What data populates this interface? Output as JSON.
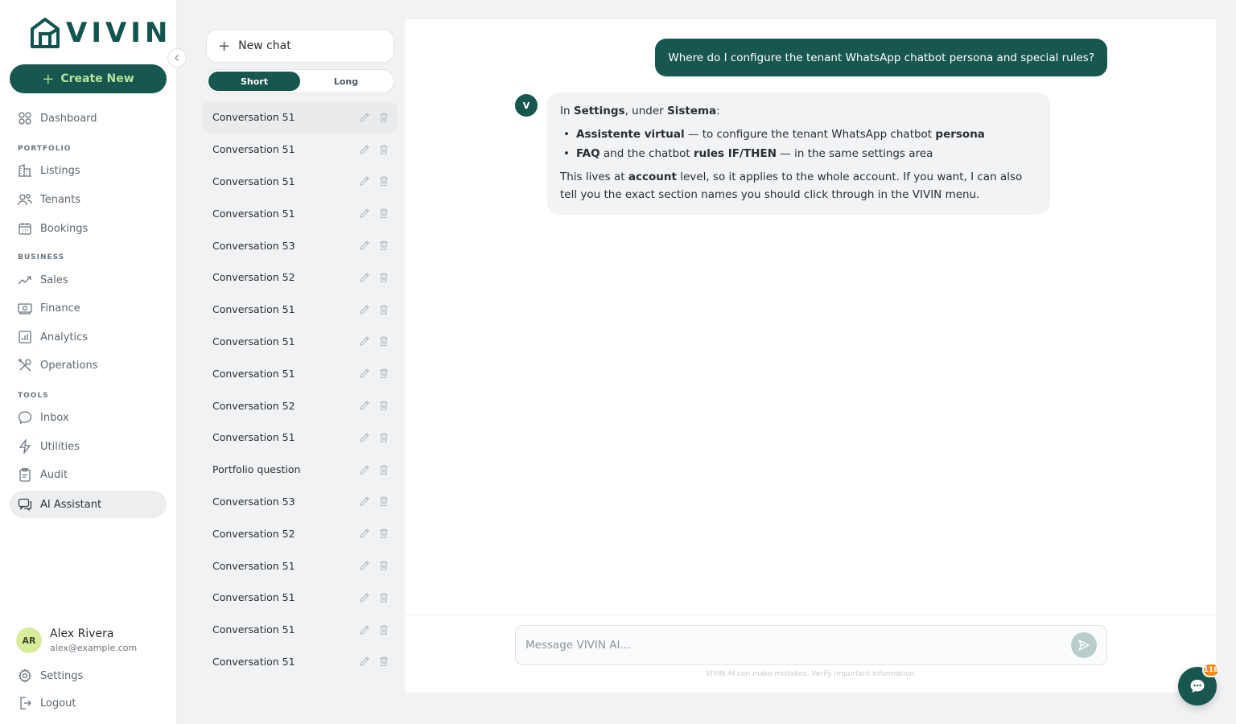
{
  "app": {
    "brand": "VIVIN",
    "create_new_label": "Create New"
  },
  "sidebar": {
    "top_item": {
      "label": "Dashboard",
      "icon": "dashboard-icon"
    },
    "sections": [
      {
        "label": "PORTFOLIO",
        "items": [
          {
            "label": "Listings",
            "icon": "building-icon"
          },
          {
            "label": "Tenants",
            "icon": "users-icon"
          },
          {
            "label": "Bookings",
            "icon": "calendar-icon"
          }
        ]
      },
      {
        "label": "BUSINESS",
        "items": [
          {
            "label": "Sales",
            "icon": "trend-icon"
          },
          {
            "label": "Finance",
            "icon": "cash-icon"
          },
          {
            "label": "Analytics",
            "icon": "chart-icon"
          },
          {
            "label": "Operations",
            "icon": "tools-icon"
          }
        ]
      },
      {
        "label": "TOOLS",
        "items": [
          {
            "label": "Inbox",
            "icon": "chat-icon"
          },
          {
            "label": "Utilities",
            "icon": "bolt-icon"
          },
          {
            "label": "Audit",
            "icon": "clipboard-icon"
          },
          {
            "label": "AI Assistant",
            "icon": "ai-chat-icon",
            "active": true
          }
        ]
      }
    ],
    "user": {
      "initials": "AR",
      "name": "Alex Rivera",
      "email": "alex@example.com"
    },
    "settings_label": "Settings",
    "logout_label": "Logout"
  },
  "conversations": {
    "new_chat_label": "New chat",
    "toggle": {
      "short": "Short",
      "long": "Long",
      "selected": "Short"
    },
    "items": [
      "Conversation 51",
      "Conversation 51",
      "Conversation 51",
      "Conversation 51",
      "Conversation 53",
      "Conversation 52",
      "Conversation 51",
      "Conversation 51",
      "Conversation 51",
      "Conversation 52",
      "Conversation 51",
      "Portfolio question",
      "Conversation 53",
      "Conversation 52",
      "Conversation 51",
      "Conversation 51",
      "Conversation 51",
      "Conversation 51"
    ]
  },
  "chat": {
    "user_message": "Where do I configure the tenant WhatsApp chatbot persona and special rules?",
    "bot_avatar": "V",
    "bot_reply": {
      "intro_pre": "In ",
      "intro_b1": "Settings",
      "intro_mid": ", under ",
      "intro_b2": "Sistema",
      "intro_post": ":",
      "bullet1_b": "Assistente virtual",
      "bullet1_mid": " — to configure the tenant WhatsApp chatbot ",
      "bullet1_b2": "persona",
      "bullet2_b": "FAQ",
      "bullet2_mid": " and the chatbot ",
      "bullet2_b2": "rules IF/THEN",
      "bullet2_post": " — in the same settings area",
      "outro_pre": "This lives at ",
      "outro_b": "account",
      "outro_post": " level, so it applies to the whole account. If you want, I can also tell you the exact section names you should click through in the VIVIN menu."
    },
    "composer_placeholder": "Message VIVIN AI...",
    "disclaimer": "VIVIN AI can make mistakes. Verify important information."
  },
  "fab": {
    "badge": "118"
  },
  "colors": {
    "brand": "#17574f",
    "accent": "#a9d98e",
    "badge": "#f08a12"
  }
}
